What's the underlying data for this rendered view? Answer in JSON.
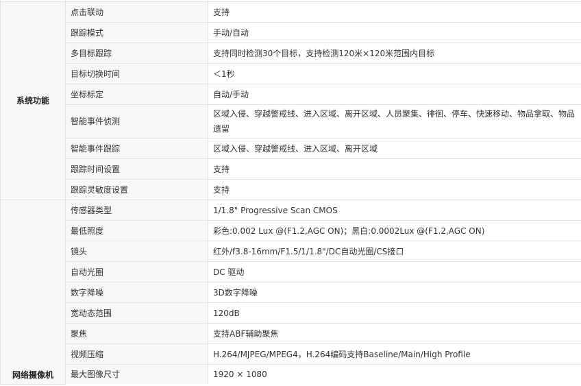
{
  "groups": [
    {
      "label": "系统功能",
      "rows": [
        {
          "name": "点击联动",
          "value": "支持"
        },
        {
          "name": "跟踪模式",
          "value": "手动/自动"
        },
        {
          "name": "多目标跟踪",
          "value": "支持同时检测30个目标，支持检测120米×120米范围内目标"
        },
        {
          "name": "目标切换时间",
          "value": "＜1秒"
        },
        {
          "name": "坐标标定",
          "value": "自动/手动"
        },
        {
          "name": "智能事件侦测",
          "value": "区域入侵、穿越警戒线、进入区域、离开区域、人员聚集、徘徊、停车、快速移动、物品拿取、物品遗留"
        },
        {
          "name": "智能事件跟踪",
          "value": "区域入侵、穿越警戒线、进入区域、离开区域"
        },
        {
          "name": "跟踪时间设置",
          "value": "支持"
        },
        {
          "name": "跟踪灵敏度设置",
          "value": "支持"
        }
      ]
    },
    {
      "label": "网络摄像机",
      "rows": [
        {
          "name": "传感器类型",
          "value": "1/1.8\"  Progressive Scan CMOS"
        },
        {
          "name": "最低照度",
          "value": "彩色:0.002 Lux @(F1.2,AGC ON)；黑白:0.0002Lux @(F1.2,AGC ON)"
        },
        {
          "name": "镜头",
          "value": "红外/f3.8-16mm/F1.5/1/1.8\"/DC自动光圈/CS接口"
        },
        {
          "name": "自动光圈",
          "value": "DC 驱动"
        },
        {
          "name": "数字降噪",
          "value": "3D数字降噪"
        },
        {
          "name": "宽动态范围",
          "value": "120dB"
        },
        {
          "name": "聚焦",
          "value": "支持ABF辅助聚焦"
        },
        {
          "name": "视频压缩",
          "value": "H.264/MJPEG/MPEG4，H.264编码支持Baseline/Main/High Profile"
        },
        {
          "name": "最大图像尺寸",
          "value": "1920 × 1080"
        }
      ]
    }
  ]
}
